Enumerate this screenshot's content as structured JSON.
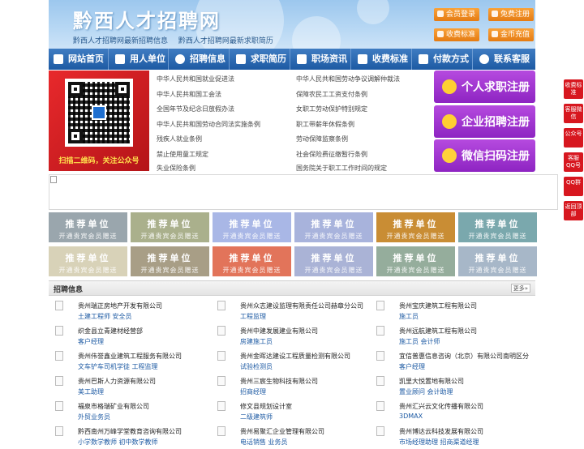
{
  "header": {
    "title": "黔西人才招聘网",
    "subtitles": [
      "黔西人才招聘网最新招聘信息",
      "黔西人才招聘网最新求职简历"
    ],
    "buttons": [
      {
        "label": "会员登录",
        "icon": "user-icon"
      },
      {
        "label": "免费注册",
        "icon": "register-icon"
      },
      {
        "label": "收费标准",
        "icon": "price-icon"
      },
      {
        "label": "金币充值",
        "icon": "coin-icon"
      }
    ]
  },
  "nav": {
    "items": [
      {
        "label": "网站首页",
        "icon": "home-icon"
      },
      {
        "label": "用人单位",
        "icon": "building-icon"
      },
      {
        "label": "招聘信息",
        "icon": "recruit-icon"
      },
      {
        "label": "求职简历",
        "icon": "resume-icon"
      },
      {
        "label": "职场资讯",
        "icon": "news-icon"
      },
      {
        "label": "收费标准",
        "icon": "price-icon"
      },
      {
        "label": "付款方式",
        "icon": "payment-icon"
      },
      {
        "label": "联系客服",
        "icon": "phone-icon"
      }
    ]
  },
  "qr": {
    "caption": "扫描二维码，关注公众号"
  },
  "laws": [
    "中华人民共和国就业促进法",
    "中华人民共和国劳动争议调解仲裁法",
    "中华人民共和国工会法",
    "保障农民工工资支付条例",
    "全国年节及纪念日放假办法",
    "女职工劳动保护特别规定",
    "中华人民共和国劳动合同法实施条例",
    "职工带薪年休假条例",
    "残疾人就业条例",
    "劳动保障监察条例",
    "禁止使用童工规定",
    "社会保险费征缴暂行条例",
    "失业保险条例",
    "国务院关于职工工作时间的规定"
  ],
  "register": [
    {
      "label": "个人求职注册",
      "icon": "person-icon"
    },
    {
      "label": "企业招聘注册",
      "icon": "company-icon"
    },
    {
      "label": "微信扫码注册",
      "icon": "wechat-icon"
    }
  ],
  "recommend": {
    "title": "推荐单位",
    "subtitle": "开通贵宾会员赠送",
    "colors": [
      "#9aa6ad",
      "#aab08c",
      "#a9b7e6",
      "#a8b3dc",
      "#c98d34",
      "#7aa8ad",
      "#d8d2b8",
      "#a89e86",
      "#e2745a",
      "#aab3d6",
      "#95ad9c",
      "#a7b7c8"
    ]
  },
  "jobs": {
    "title": "招聘信息",
    "more": "更多»",
    "items": [
      {
        "company": "贵州瑞正房地产开发有限公司",
        "positions": "土建工程师 安全员"
      },
      {
        "company": "贵州众志建设监理有限责任公司赫章分公司",
        "positions": "工程监理"
      },
      {
        "company": "贵州宝庆建筑工程有限公司",
        "positions": "施工员"
      },
      {
        "company": "织金县立青建材经营部",
        "positions": "客户经理"
      },
      {
        "company": "贵州中建发展建业有限公司",
        "positions": "房建施工员"
      },
      {
        "company": "贵州远航建筑工程有限公司",
        "positions": "施工员 会计师"
      },
      {
        "company": "贵州伟誉鑫业建筑工程服务有限公司",
        "positions": "文车铲车司机学徒 工程监理"
      },
      {
        "company": "贵州金晖达建设工程质量检测有限公司",
        "positions": "试验检测员"
      },
      {
        "company": "宜信普惠信息咨询（北京）有限公司南明区分",
        "positions": "客户经理"
      },
      {
        "company": "贵州巴斯人力资源有限公司",
        "positions": "美工助理"
      },
      {
        "company": "贵州三宸生物科技有限公司",
        "positions": "招商经理"
      },
      {
        "company": "凯里大悦置地有限公司",
        "positions": "置业顾问 会计助理"
      },
      {
        "company": "福泉市格瑞矿业有限公司",
        "positions": "外贸业务员"
      },
      {
        "company": "修文县规划设计室",
        "positions": "二级建筑师"
      },
      {
        "company": "贵州汇兴云文化传播有限公司",
        "positions": "3DMAX"
      },
      {
        "company": "黔西南州万峰学堂教育咨询有限公司",
        "positions": "小学数学教师 初中数学教师"
      },
      {
        "company": "贵州易聚汇企业管理有限公司",
        "positions": "电话销售 业务员"
      },
      {
        "company": "贵州博达云科技发展有限公司",
        "positions": "市场经理助理 招商渠道经理"
      }
    ]
  },
  "side": [
    {
      "label": "收费标准"
    },
    {
      "label": "客服微信"
    },
    {
      "label": "公众号"
    },
    {
      "label": "客服QQ号"
    },
    {
      "label": "QQ群"
    },
    {
      "label": "返回顶部"
    }
  ]
}
